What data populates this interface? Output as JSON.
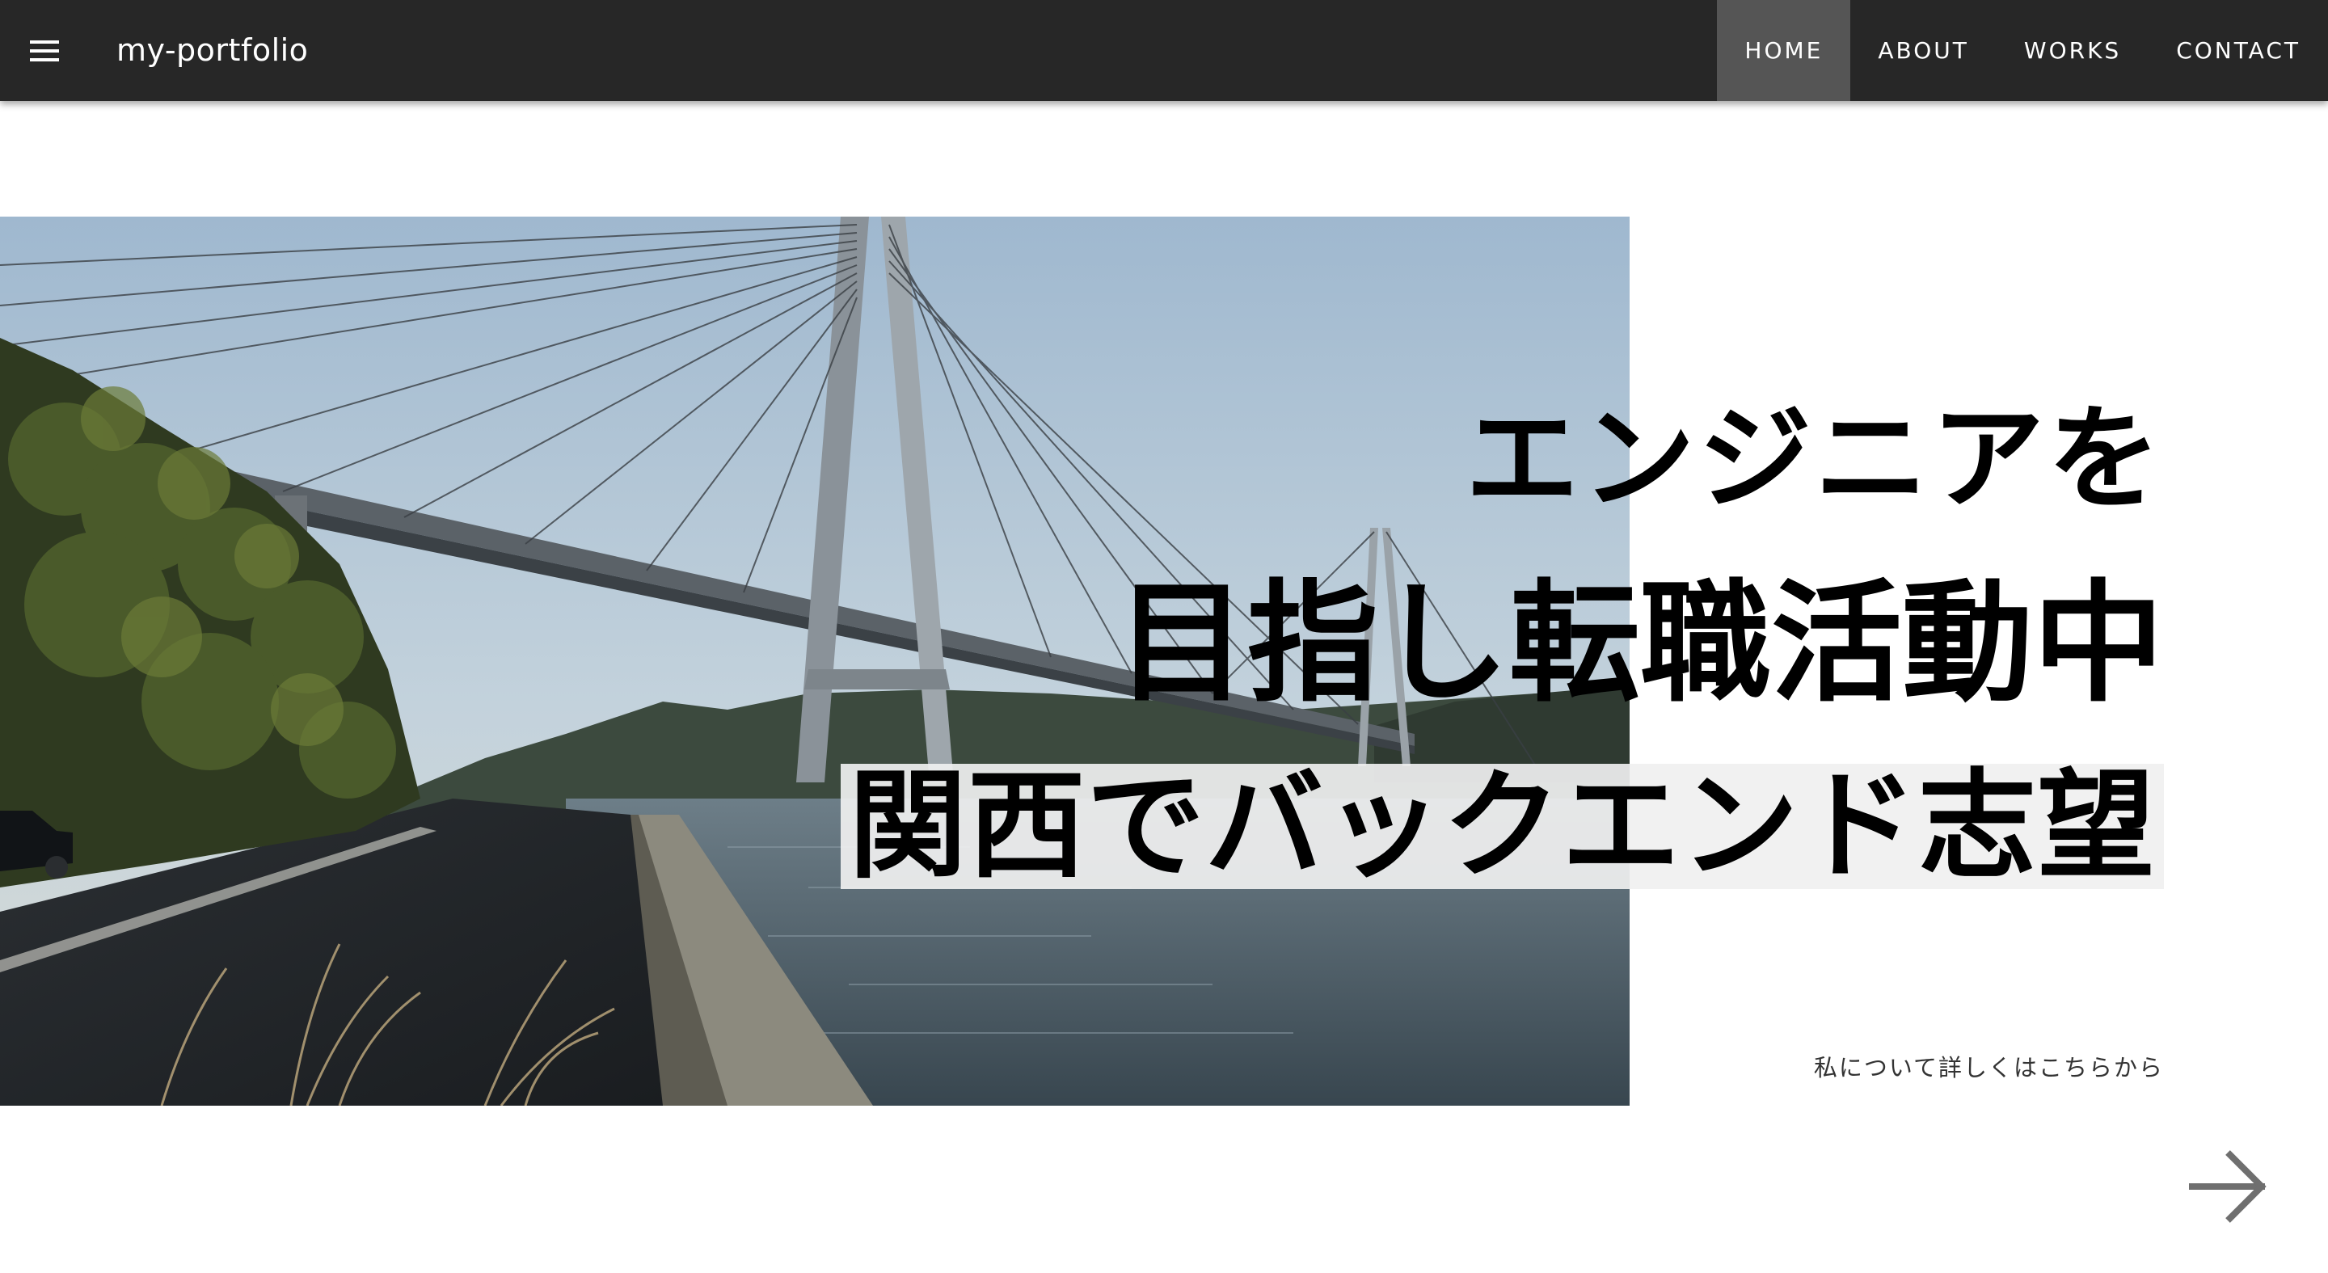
{
  "header": {
    "brand": "my-portfolio",
    "menu_icon": "hamburger-menu-icon",
    "nav": [
      {
        "label": "HOME",
        "active": true
      },
      {
        "label": "ABOUT",
        "active": false
      },
      {
        "label": "WORKS",
        "active": false
      },
      {
        "label": "CONTACT",
        "active": false
      }
    ]
  },
  "hero": {
    "line1": "エンジニアを",
    "line2": "目指し転職活動中",
    "line3": "関西でバックエンド志望",
    "about_link": "私について詳しくはこちらから",
    "next_icon": "arrow-right-icon",
    "photo": "cable-stayed-bridge-photo"
  },
  "colors": {
    "navbar_bg": "#272727",
    "nav_active_bg": "#555555",
    "highlight_bg": "#f0f0f0",
    "arrow": "#6f6f6f"
  }
}
